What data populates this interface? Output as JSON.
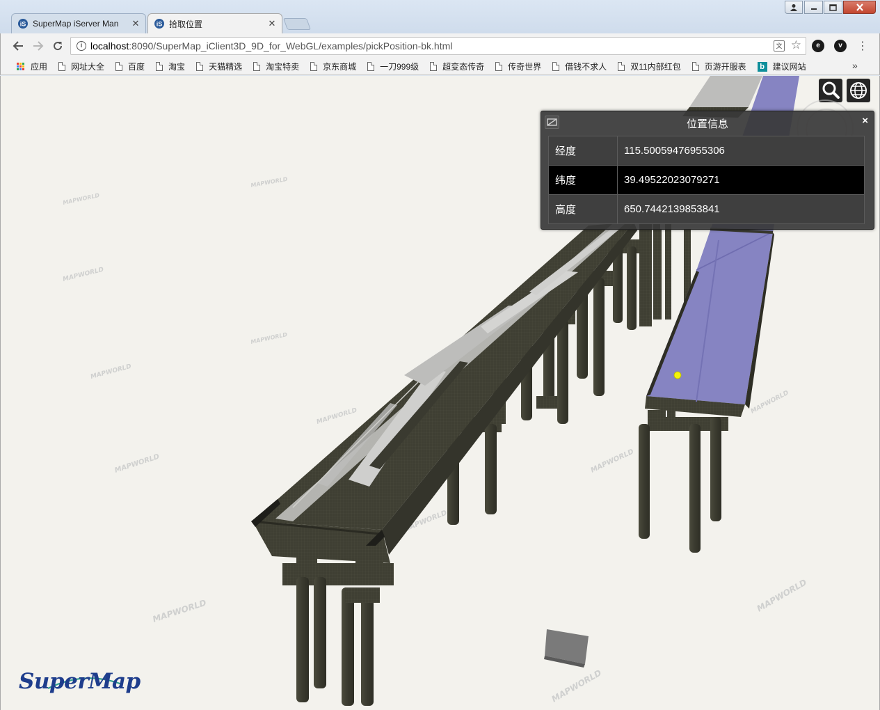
{
  "browser": {
    "tabs": [
      {
        "title": "SuperMap iServer Man",
        "active": false
      },
      {
        "title": "拾取位置",
        "active": true
      }
    ],
    "url_host": "localhost",
    "url_rest": ":8090/SuperMap_iClient3D_9D_for_WebGL/examples/pickPosition-bk.html",
    "bookmarks": [
      {
        "label": "应用",
        "icon": "apps-icon"
      },
      {
        "label": "网址大全",
        "icon": "page-icon"
      },
      {
        "label": "百度",
        "icon": "page-icon"
      },
      {
        "label": "淘宝",
        "icon": "page-icon"
      },
      {
        "label": "天猫精选",
        "icon": "page-icon"
      },
      {
        "label": "淘宝特卖",
        "icon": "page-icon"
      },
      {
        "label": "京东商城",
        "icon": "page-icon"
      },
      {
        "label": "一刀999级",
        "icon": "page-icon"
      },
      {
        "label": "超变态传奇",
        "icon": "page-icon"
      },
      {
        "label": "传奇世界",
        "icon": "page-icon"
      },
      {
        "label": "借钱不求人",
        "icon": "page-icon"
      },
      {
        "label": "双11内部红包",
        "icon": "page-icon"
      },
      {
        "label": "页游开服表",
        "icon": "page-icon"
      },
      {
        "label": "建议网站",
        "icon": "bing-icon"
      }
    ],
    "more_label": "»"
  },
  "info_panel": {
    "title": "位置信息",
    "close_label": "×",
    "rows": [
      {
        "key": "经度",
        "value": "115.50059476955306"
      },
      {
        "key": "纬度",
        "value": "39.49522023079271"
      },
      {
        "key": "高度",
        "value": "650.7442139853841"
      }
    ]
  },
  "logo_text": "SuperMap",
  "watermark_text": "MAPWORLD",
  "colors": {
    "pier": "#3f3f33",
    "deck": "#3d3d31",
    "road_light": "#c9c9c7",
    "purple_deck": "#8684c2",
    "picked_point": "#f3f30a",
    "ground": "#f3f2ed",
    "panel_bg": "#383838"
  }
}
